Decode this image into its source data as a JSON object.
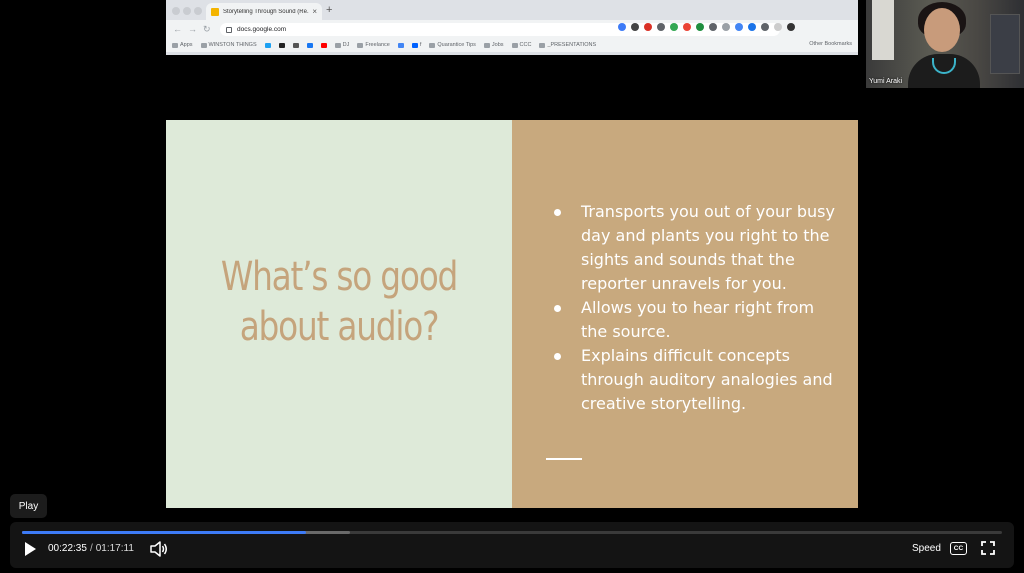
{
  "browser": {
    "tab_title": "Storytelling Through Sound (Re...",
    "url": "docs.google.com",
    "bookmarks": [
      "Apps",
      "WINSTON THINGS",
      "",
      "",
      "",
      "",
      "",
      "DJ",
      "Freelance",
      "",
      "f",
      "Quarantice Tips",
      "Jobs",
      "CCC",
      "_PRESENTATIONS"
    ],
    "other_bookmarks": "Other Bookmarks"
  },
  "slide": {
    "title_line1": "What’s so good",
    "title_line2": "about audio?",
    "bullets": [
      "Transports you out of your busy day and plants you right to the sights and sounds that the reporter unravels for you.",
      "Allows you to hear right from the source.",
      "Explains difficult concepts through auditory analogies and creative storytelling."
    ],
    "colors": {
      "left_bg": "#deead9",
      "right_bg": "#c8a97e",
      "title": "#c5a47c"
    }
  },
  "webcam": {
    "name": "Yumi Araki"
  },
  "player": {
    "tooltip": "Play",
    "current_time": "00:22:35",
    "separator": "/",
    "duration": "01:17:11",
    "speed_label": "Speed",
    "cc_label": "CC",
    "progress": 0.29,
    "buffered": 0.335,
    "accent": "#3d7bf7"
  }
}
